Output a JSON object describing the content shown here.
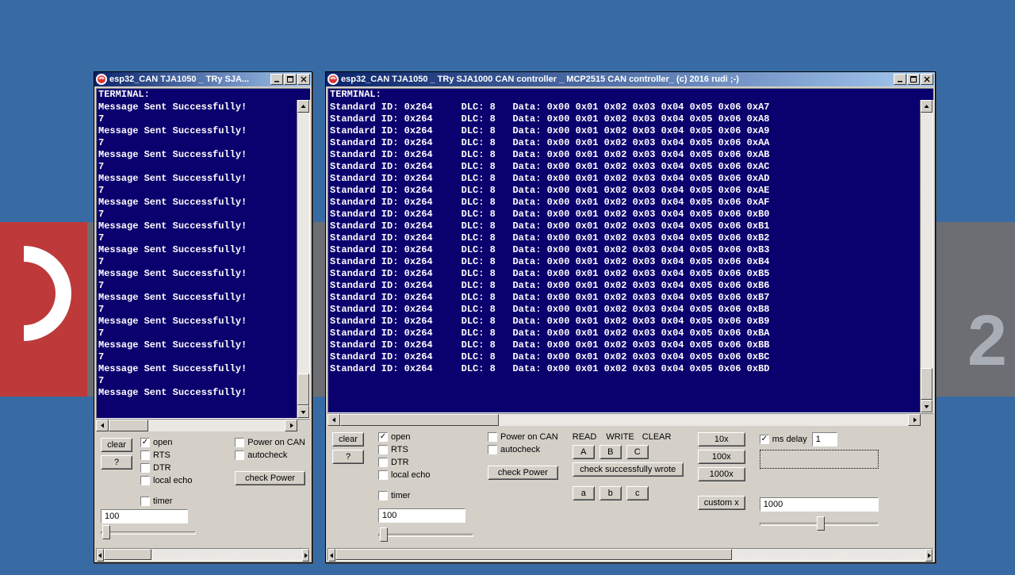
{
  "left_window": {
    "title": "esp32_CAN TJA1050 _ TRy SJA...",
    "term_label": "TERMINAL:",
    "messages": [
      "Message Sent Successfully!",
      "7",
      "Message Sent Successfully!",
      "7",
      "Message Sent Successfully!",
      "7",
      "Message Sent Successfully!",
      "7",
      "Message Sent Successfully!",
      "7",
      "Message Sent Successfully!",
      "7",
      "Message Sent Successfully!",
      "7",
      "Message Sent Successfully!",
      "7",
      "Message Sent Successfully!",
      "7",
      "Message Sent Successfully!",
      "7",
      "Message Sent Successfully!",
      "7",
      "Message Sent Successfully!",
      "7",
      "Message Sent Successfully!"
    ],
    "buttons": {
      "clear": "clear",
      "help": "?",
      "check_power": "check Power"
    },
    "checks": {
      "open": "open",
      "rts": "RTS",
      "dtr": "DTR",
      "local_echo": "local echo",
      "timer": "timer",
      "power_on_can": "Power on CAN",
      "autocheck": "autocheck"
    },
    "input_value": "100"
  },
  "right_window": {
    "title": "esp32_CAN TJA1050 _ TRy SJA1000 CAN controller _ MCP2515 CAN controller_ (c) 2016 rudi ;-)",
    "term_label": "TERMINAL:",
    "rows_suffix": [
      "0xA7",
      "0xA8",
      "0xA9",
      "0xAA",
      "0xAB",
      "0xAC",
      "0xAD",
      "0xAE",
      "0xAF",
      "0xB0",
      "0xB1",
      "0xB2",
      "0xB3",
      "0xB4",
      "0xB5",
      "0xB6",
      "0xB7",
      "0xB8",
      "0xB9",
      "0xBA",
      "0xBB",
      "0xBC",
      "0xBD"
    ],
    "row_prefix": "Standard ID: 0x264     DLC: 8   Data: 0x00 0x01 0x02 0x03 0x04 0x05 0x06 ",
    "buttons": {
      "clear": "clear",
      "help": "?",
      "check_power": "check Power",
      "A": "A",
      "B": "B",
      "C": "C",
      "a": "a",
      "b": "b",
      "c": "c",
      "check_wrote": "check successfully wrote",
      "x10": "10x",
      "x100": "100x",
      "x1000": "1000x",
      "custom": "custom x"
    },
    "labels": {
      "read": "READ",
      "write": "WRITE",
      "clear": "CLEAR"
    },
    "checks": {
      "open": "open",
      "rts": "RTS",
      "dtr": "DTR",
      "local_echo": "local echo",
      "timer": "timer",
      "power_on_can": "Power on CAN",
      "autocheck": "autocheck",
      "ms_delay": "ms delay"
    },
    "inputs": {
      "left_val": "100",
      "ms_delay_val": "1",
      "right_val": "1000"
    }
  }
}
